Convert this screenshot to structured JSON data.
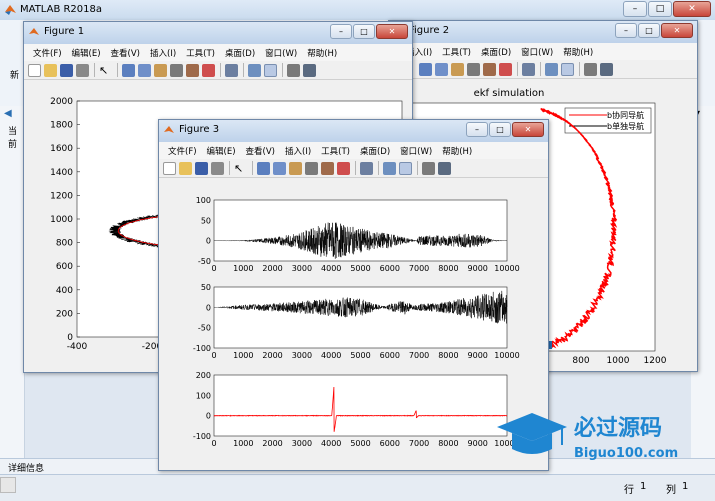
{
  "main_window": {
    "title": "MATLAB R2018a",
    "toolstrip_partial_label": "新",
    "side_partial_label": "当前",
    "detail_panel": "详细信息",
    "status": {
      "row_label": "行",
      "row_value": "1",
      "col_label": "列",
      "col_value": "1"
    }
  },
  "figure_menu": [
    "文件(F)",
    "编辑(E)",
    "查看(V)",
    "插入(I)",
    "工具(T)",
    "桌面(D)",
    "窗口(W)",
    "帮助(H)"
  ],
  "figures": [
    {
      "title": "Figure 1"
    },
    {
      "title": "Figure 2",
      "plot_title": "ekf simulation",
      "legend": [
        "b协同导航",
        "b单独导航"
      ]
    },
    {
      "title": "Figure 3"
    }
  ],
  "watermark": {
    "main": "必过源码",
    "sub": "Biguo100.com"
  },
  "colors": {
    "accent_red": "#ff0000",
    "signal_black": "#000000",
    "watermark_blue": "#1f86d1"
  },
  "chart_data": [
    {
      "type": "line",
      "figure": "Figure 1",
      "xlim": [
        -400,
        400
      ],
      "ylim": [
        0,
        2000
      ],
      "xticks_visible": [
        "-400",
        "-200",
        "0"
      ],
      "yticks": [
        "0",
        "200",
        "400",
        "600",
        "800",
        "1000",
        "1200",
        "1400",
        "1600",
        "1800",
        "2000"
      ],
      "series": [
        {
          "color": "#000000",
          "shape": "ellipse",
          "center": [
            0,
            900
          ],
          "radius_x": 300,
          "radius_y": 350,
          "noisy": true
        },
        {
          "color": "#ff0000",
          "shape": "ellipse",
          "center": [
            0,
            900
          ],
          "radius_x": 290,
          "radius_y": 340
        }
      ]
    },
    {
      "type": "line",
      "figure": "Figure 2",
      "title": "ekf simulation",
      "xticks_visible": [
        "800",
        "1000",
        "1200"
      ],
      "legend": [
        "b协同导航",
        "b单独导航"
      ],
      "series": [
        {
          "name": "b协同导航",
          "color": "#ff0000"
        },
        {
          "name": "b单独导航",
          "color": "#000000"
        }
      ]
    },
    {
      "type": "line",
      "figure": "Figure 3",
      "subplots": [
        {
          "xlim": [
            0,
            10000
          ],
          "ylim": [
            -50,
            100
          ],
          "xticks": [
            "0",
            "1000",
            "2000",
            "3000",
            "4000",
            "5000",
            "6000",
            "7000",
            "8000",
            "9000",
            "10000"
          ],
          "yticks": [
            "-50",
            "0",
            "50",
            "100"
          ],
          "color": "#000000",
          "envelope": [
            [
              0,
              0
            ],
            [
              1000,
              1
            ],
            [
              1500,
              4
            ],
            [
              2000,
              8
            ],
            [
              2500,
              14
            ],
            [
              3000,
              22
            ],
            [
              3500,
              35
            ],
            [
              4000,
              50
            ],
            [
              4500,
              38
            ],
            [
              5000,
              30
            ],
            [
              5500,
              22
            ],
            [
              6000,
              18
            ],
            [
              6500,
              8
            ],
            [
              6900,
              1
            ],
            [
              7000,
              12
            ],
            [
              7500,
              13
            ],
            [
              8000,
              13
            ],
            [
              8500,
              18
            ],
            [
              9000,
              17
            ],
            [
              9300,
              10
            ],
            [
              9500,
              2
            ],
            [
              10000,
              0
            ]
          ]
        },
        {
          "xlim": [
            0,
            10000
          ],
          "ylim": [
            -100,
            50
          ],
          "xticks": [
            "0",
            "1000",
            "2000",
            "3000",
            "4000",
            "5000",
            "6000",
            "7000",
            "8000",
            "9000",
            "10000"
          ],
          "yticks": [
            "-100",
            "-50",
            "0",
            "50"
          ],
          "color": "#000000",
          "envelope": [
            [
              0,
              0
            ],
            [
              500,
              3
            ],
            [
              1000,
              6
            ],
            [
              2000,
              10
            ],
            [
              3000,
              15
            ],
            [
              4000,
              22
            ],
            [
              4500,
              25
            ],
            [
              5000,
              22
            ],
            [
              5500,
              8
            ],
            [
              5800,
              3
            ],
            [
              6000,
              8
            ],
            [
              6500,
              18
            ],
            [
              6800,
              5
            ],
            [
              7000,
              8
            ],
            [
              8000,
              15
            ],
            [
              9000,
              30
            ],
            [
              9500,
              38
            ],
            [
              10000,
              42
            ]
          ]
        },
        {
          "xlim": [
            0,
            10000
          ],
          "ylim": [
            -100,
            200
          ],
          "xticks": [
            "0",
            "1000",
            "2000",
            "3000",
            "4000",
            "5000",
            "6000",
            "7000",
            "8000",
            "9000",
            "10000"
          ],
          "yticks": [
            "-100",
            "0",
            "100",
            "200"
          ],
          "color": "#ff0000",
          "spikes": [
            {
              "x": 4100,
              "up": 155,
              "down": -80
            },
            {
              "x": 6900,
              "up": 25,
              "down": -12
            }
          ]
        }
      ]
    }
  ]
}
